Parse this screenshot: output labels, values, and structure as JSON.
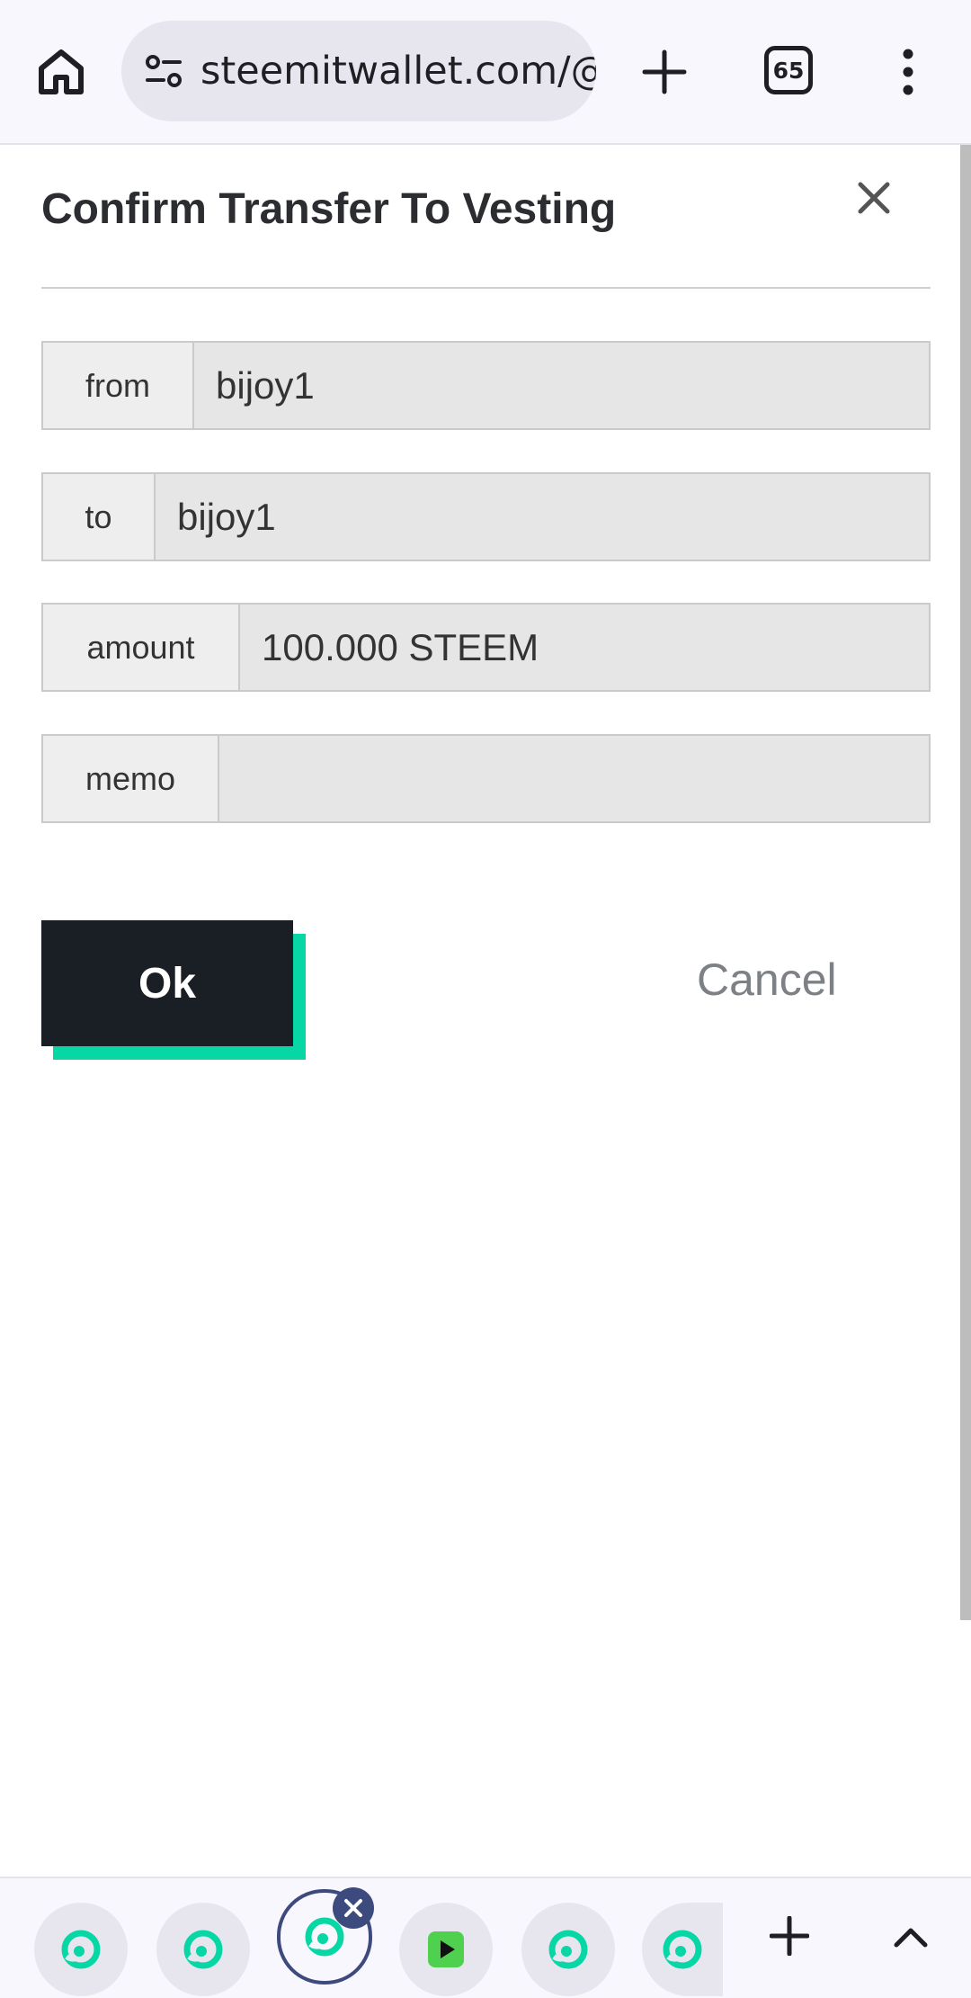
{
  "browser": {
    "url": "steemitwallet.com/@",
    "tab_count": "65",
    "icons": {
      "home": "home-icon",
      "site_info": "site-settings-icon",
      "new_tab": "plus-icon",
      "menu": "more-vertical-icon"
    }
  },
  "dialog": {
    "title": "Confirm Transfer To Vesting",
    "close_icon": "close-icon",
    "fields": {
      "from": {
        "label": "from",
        "value": "bijoy1"
      },
      "to": {
        "label": "to",
        "value": "bijoy1"
      },
      "amount": {
        "label": "amount",
        "value": "100.000 STEEM"
      },
      "memo": {
        "label": "memo",
        "value": ""
      }
    },
    "ok_label": "Ok",
    "cancel_label": "Cancel"
  },
  "tab_strip": {
    "tabs": [
      {
        "icon": "steemit-icon",
        "active": false
      },
      {
        "icon": "steemit-icon",
        "active": false
      },
      {
        "icon": "steemit-icon",
        "active": true
      },
      {
        "icon": "green-play-icon",
        "active": false
      },
      {
        "icon": "steemit-icon",
        "active": false
      },
      {
        "icon": "steemit-icon",
        "active": false
      }
    ],
    "add_icon": "plus-icon",
    "expand_icon": "chevron-up-icon"
  },
  "colors": {
    "accent": "#07d6a5",
    "ok_button": "#1a1f26",
    "active_tab_ring": "#3c4a7e"
  }
}
